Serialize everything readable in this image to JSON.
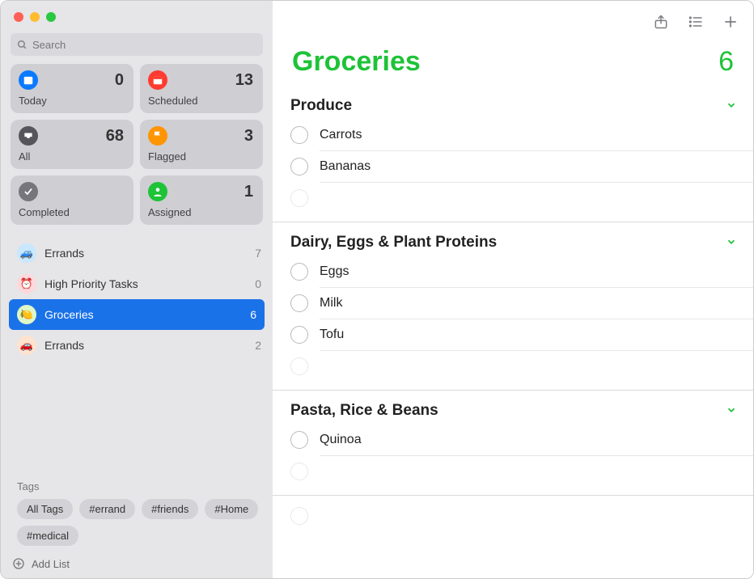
{
  "search": {
    "placeholder": "Search"
  },
  "smartLists": {
    "today": {
      "label": "Today",
      "count": "0",
      "color": "#0a7aff"
    },
    "scheduled": {
      "label": "Scheduled",
      "count": "13",
      "color": "#ff3b30"
    },
    "all": {
      "label": "All",
      "count": "68",
      "color": "#56555c"
    },
    "flagged": {
      "label": "Flagged",
      "count": "3",
      "color": "#ff9500"
    },
    "completed": {
      "label": "Completed",
      "count": "",
      "color": "#77767d"
    },
    "assigned": {
      "label": "Assigned",
      "count": "1",
      "color": "#1ec337"
    }
  },
  "lists": [
    {
      "name": "Errands",
      "count": "7",
      "active": false,
      "iconBg": "#c9e7ff",
      "emoji": "🚙"
    },
    {
      "name": "High Priority Tasks",
      "count": "0",
      "active": false,
      "iconBg": "#ffd8dc",
      "emoji": "⏰"
    },
    {
      "name": "Groceries",
      "count": "6",
      "active": true,
      "iconBg": "#dff6c7",
      "emoji": "🍋"
    },
    {
      "name": "Errands",
      "count": "2",
      "active": false,
      "iconBg": "#ffe3cf",
      "emoji": "🚗"
    }
  ],
  "tagsSection": {
    "title": "Tags",
    "tags": [
      "All Tags",
      "#errand",
      "#friends",
      "#Home",
      "#medical"
    ]
  },
  "footer": {
    "addList": "Add List"
  },
  "main": {
    "title": "Groceries",
    "count": "6",
    "accent": "#1ec337",
    "sections": [
      {
        "title": "Produce",
        "items": [
          "Carrots",
          "Bananas"
        ]
      },
      {
        "title": "Dairy, Eggs & Plant Proteins",
        "items": [
          "Eggs",
          "Milk",
          "Tofu"
        ]
      },
      {
        "title": "Pasta, Rice & Beans",
        "items": [
          "Quinoa"
        ]
      }
    ]
  }
}
